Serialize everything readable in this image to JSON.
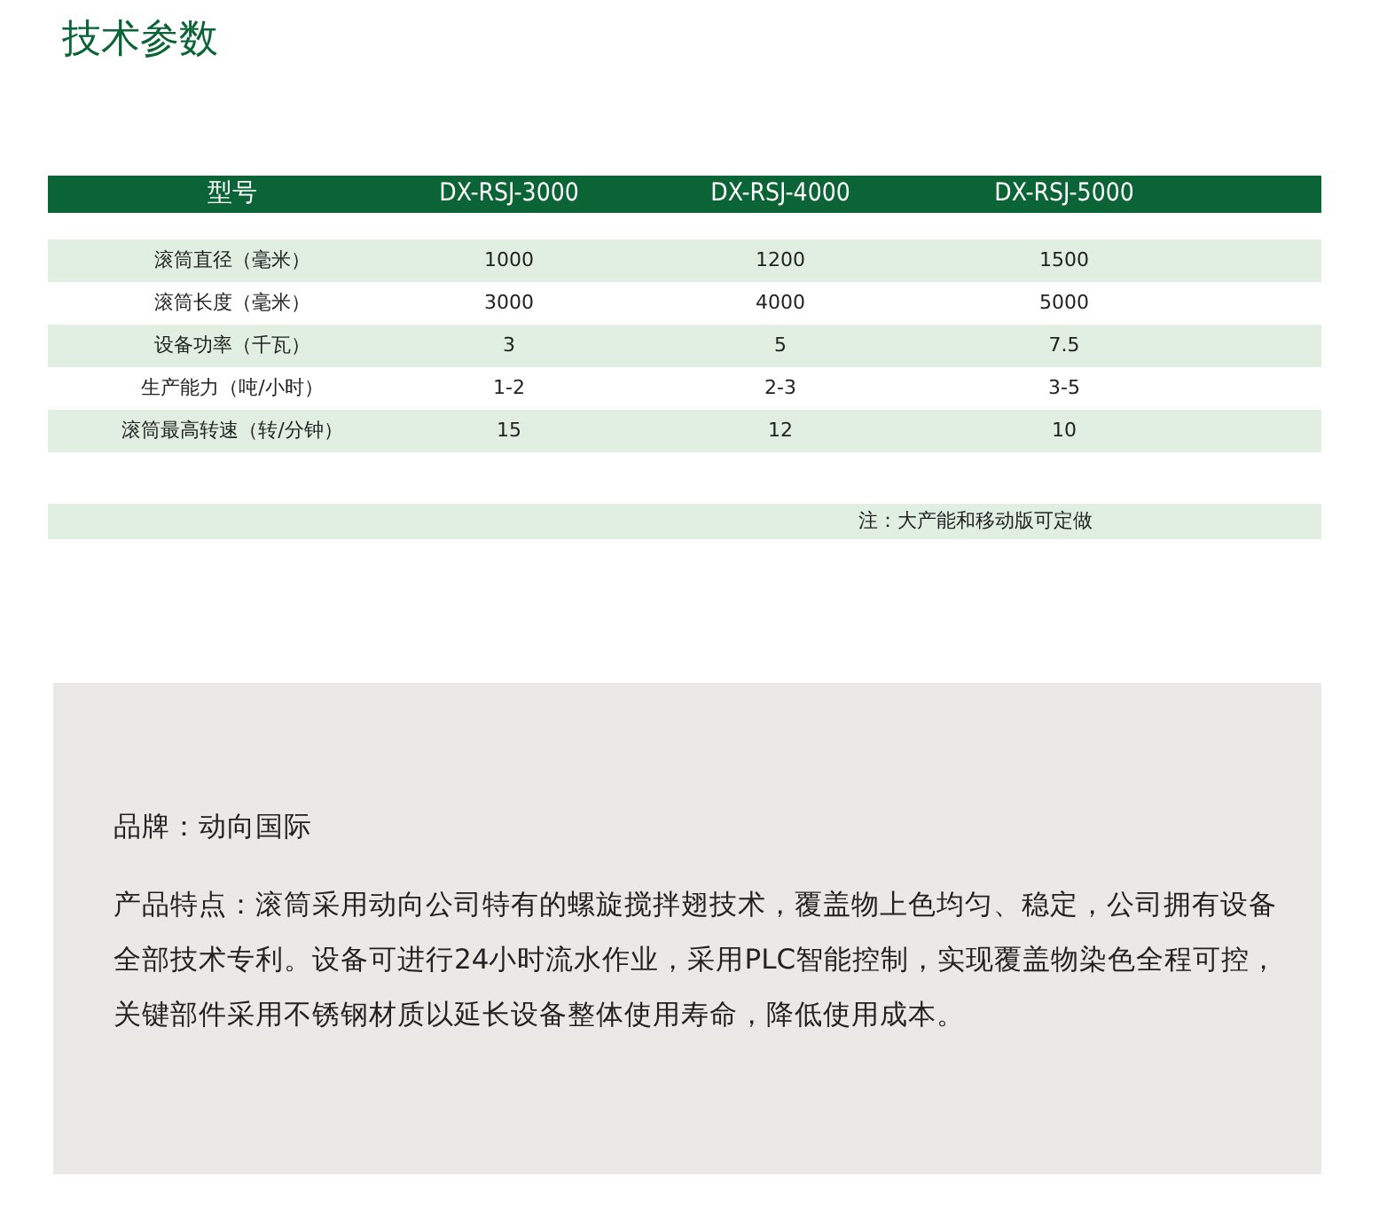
{
  "title": "技术参数",
  "table": {
    "columns": [
      "型号",
      "DX-RSJ-3000",
      "DX-RSJ-4000",
      "DX-RSJ-5000"
    ],
    "rows": [
      {
        "label": "滚筒直径（毫米）",
        "values": [
          "1000",
          "1200",
          "1500"
        ]
      },
      {
        "label": "滚筒长度（毫米）",
        "values": [
          "3000",
          "4000",
          "5000"
        ]
      },
      {
        "label": "设备功率（千瓦）",
        "values": [
          "3",
          "5",
          "7.5"
        ]
      },
      {
        "label": "生产能力（吨/小时）",
        "values": [
          "1-2",
          "2-3",
          "3-5"
        ]
      },
      {
        "label": "滚筒最高转速（转/分钟）",
        "values": [
          "15",
          "12",
          "10"
        ]
      }
    ],
    "note": "注：大产能和移动版可定做"
  },
  "panel": {
    "brand": "品牌：动向国际",
    "description": "产品特点：滚筒采用动向公司特有的螺旋搅拌翅技术，覆盖物上色均匀、稳定，公司拥有设备全部技术专利。设备可进行24小时流水作业，采用PLC智能控制，实现覆盖物染色全程可控，关键部件采用不锈钢材质以延长设备整体使用寿命，降低使用成本。"
  }
}
